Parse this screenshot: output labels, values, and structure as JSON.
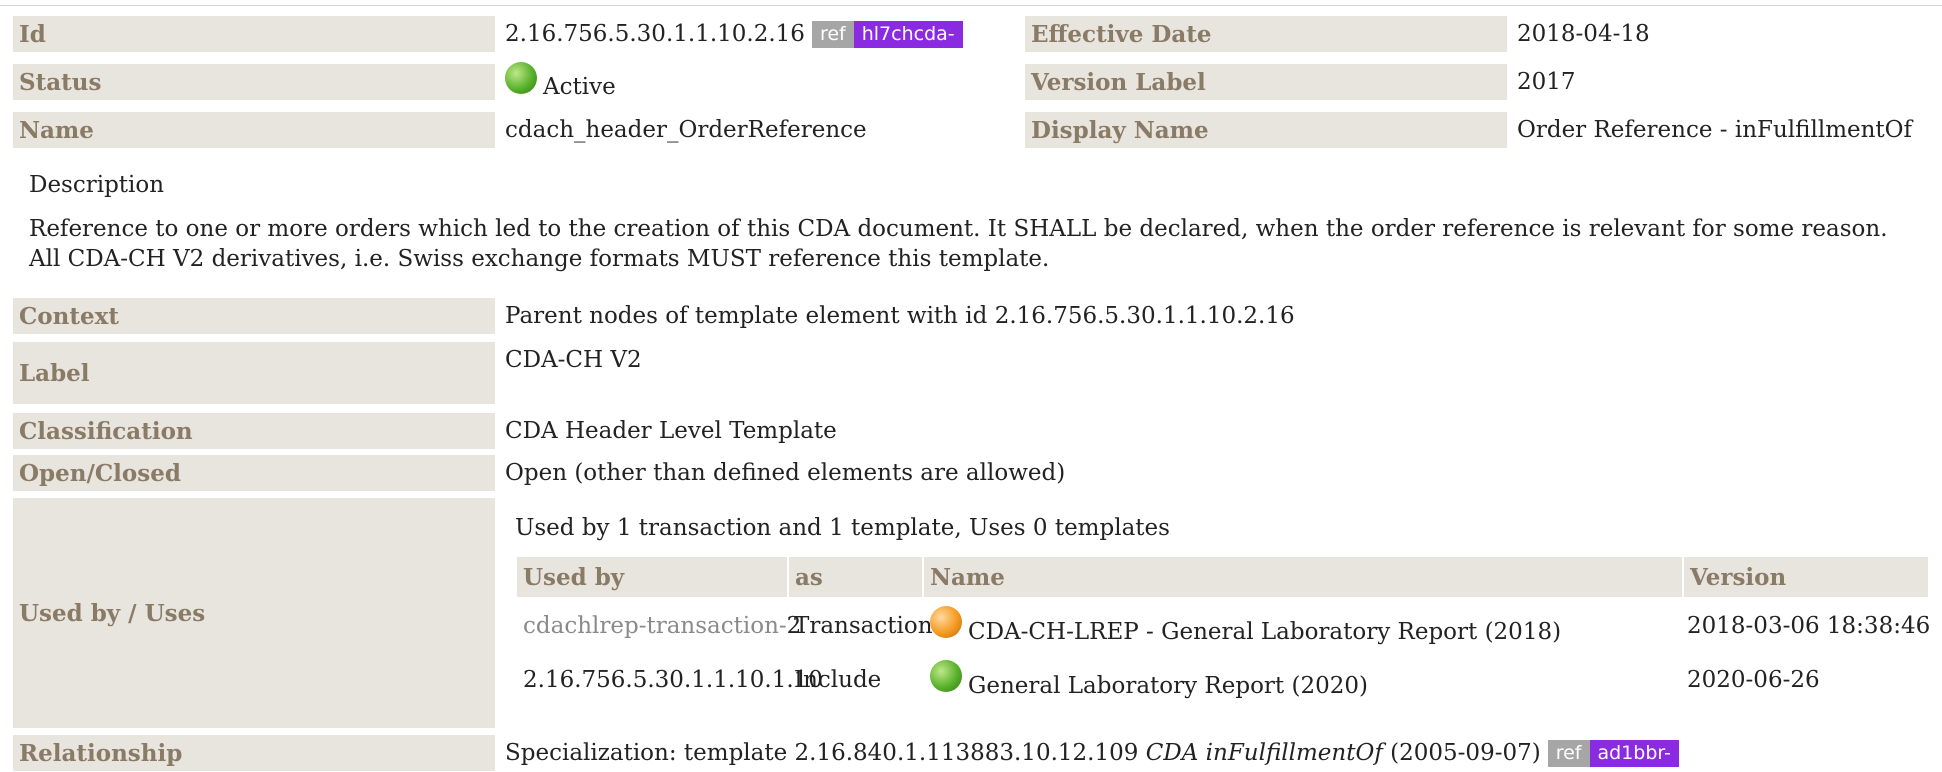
{
  "header": {
    "id_label": "Id",
    "id_value": "2.16.756.5.30.1.1.10.2.16",
    "id_ref": "ref",
    "id_prefix": "hl7chcda-",
    "effective_date_label": "Effective Date",
    "effective_date_value": "2018-04-18",
    "status_label": "Status",
    "status_value": "Active",
    "status_color": "#58b12b",
    "version_label_label": "Version Label",
    "version_label_value": "2017",
    "name_label": "Name",
    "name_value": "cdach_header_OrderReference",
    "display_name_label": "Display Name",
    "display_name_value": "Order Reference - inFulfillmentOf"
  },
  "description": {
    "heading": "Description",
    "text": "Reference to one or more orders which led to the creation of this CDA document. It SHALL be declared, when the order reference is relevant for some reason. All CDA-CH V2 derivatives, i.e. Swiss exchange formats MUST reference this template."
  },
  "details": {
    "context_label": "Context",
    "context_value": "Parent nodes of template element with id 2.16.756.5.30.1.1.10.2.16",
    "label_label": "Label",
    "label_value": "CDA-CH V2",
    "classification_label": "Classification",
    "classification_value": "CDA Header Level Template",
    "open_closed_label": "Open/Closed",
    "open_closed_value": "Open (other than defined elements are allowed)"
  },
  "used_by": {
    "label": "Used by / Uses",
    "summary": "Used by 1 transaction and 1 template, Uses 0 templates",
    "columns": [
      "Used by",
      "as",
      "Name",
      "Version"
    ],
    "rows": [
      {
        "used_by_link": "cdachlrep-transaction-",
        "used_by_suffix": "2",
        "as": "Transaction",
        "status": "orange",
        "name": "CDA-CH-LREP - General Laboratory Report (2018)",
        "version": "2018-03-06 18:38:46"
      },
      {
        "used_by_link": "",
        "used_by_suffix": "2.16.756.5.30.1.1.10.1.10",
        "as": "Include",
        "status": "green",
        "name": "General Laboratory Report (2020)",
        "version": "2020-06-26"
      }
    ]
  },
  "relationship": {
    "label": "Relationship",
    "prefix": "Specialization: template 2.16.840.1.113883.10.12.109 ",
    "template_name": "CDA inFulfillmentOf",
    "date": " (2005-09-07)",
    "ref": "ref",
    "ref_prefix": "ad1bbr-"
  },
  "colors": {
    "label_bg": "#e8e4de",
    "label_text": "#8a7b66",
    "badge_grey": "#a6a6a6",
    "badge_purple": "#8a2be2"
  }
}
